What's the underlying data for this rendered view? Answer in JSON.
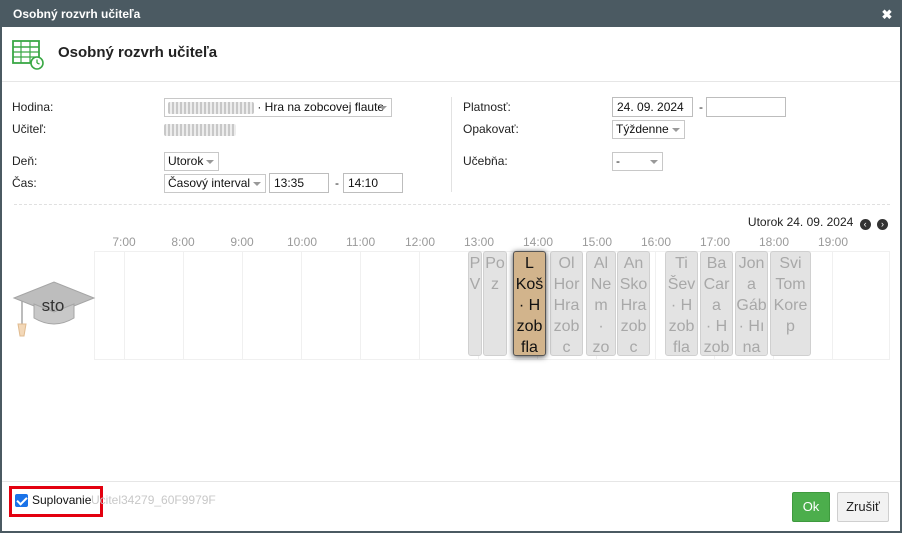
{
  "window": {
    "title": "Osobný rozvrh učiteľa",
    "close_glyph": "✖"
  },
  "header": {
    "title": "Osobný rozvrh učiteľa",
    "icon": "timetable-clock-icon"
  },
  "form": {
    "hodina_label": "Hodina:",
    "hodina_value": "· Hra na zobcovej flaute",
    "ucitel_label": "Učiteľ:",
    "den_label": "Deň:",
    "den_value": "Utorok",
    "cas_label": "Čas:",
    "cas_type": "Časový interval",
    "cas_from": "13:35",
    "cas_dash": "-",
    "cas_to": "14:10",
    "platnost_label": "Platnosť:",
    "platnost_from": "24. 09. 2024",
    "platnost_dash": "-",
    "platnost_to": "",
    "opakovat_label": "Opakovať:",
    "opakovat_value": "Týždenne",
    "ucebna_label": "Učebňa:",
    "ucebna_value": "-"
  },
  "timeline": {
    "date_label": "Utorok 24. 09. 2024",
    "prev_icon": "arrow-left-circle-icon",
    "next_icon": "arrow-right-circle-icon",
    "hours": [
      "7:00",
      "8:00",
      "9:00",
      "10:00",
      "11:00",
      "12:00",
      "13:00",
      "14:00",
      "15:00",
      "16:00",
      "17:00",
      "18:00",
      "19:00"
    ],
    "room_label": "sto",
    "events": [
      {
        "text": "P\nV",
        "selected": false
      },
      {
        "text": "Po\nz",
        "selected": false
      },
      {
        "text": "L\nKoš\n· H\nzob\nfla",
        "selected": true
      },
      {
        "text": "Ol\nHor\nHra\nzobc\nfla",
        "selected": false
      },
      {
        "text": "Al\nNem\n·\nzo\nfla",
        "selected": false
      },
      {
        "text": "An\nSko\nHra\nzobc\nfla",
        "selected": false
      },
      {
        "text": "Ti\nŠev\n· H\nzob\nfla",
        "selected": false
      },
      {
        "text": "Ba\nCara\n· H\nzob\nfl",
        "selected": false
      },
      {
        "text": "Jona\nGáb\n· Hı\nna\ntrúb",
        "selected": false
      },
      {
        "text": "Svi\nTom\nKorep",
        "selected": false
      }
    ]
  },
  "footer": {
    "suplovanie_label": "Suplovanie",
    "suplovanie_checked": true,
    "ghost_id": "Ucitel34279_60F9979F",
    "ok_label": "Ok",
    "cancel_label": "Zrušiť"
  },
  "colors": {
    "titlebar": "#4b5a62",
    "ok": "#4cae4c",
    "selected_event": "#d2b48c",
    "highlight": "#e3000f"
  }
}
